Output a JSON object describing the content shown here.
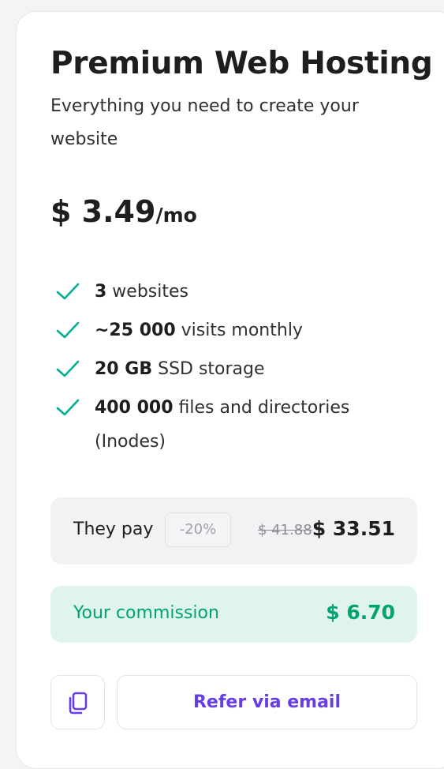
{
  "plan": {
    "title": "Premium Web Hosting",
    "subtitle": "Everything you need to create your website",
    "price": "$ 3.49",
    "price_period": "/mo"
  },
  "features": [
    {
      "bold": "3",
      "text": " websites"
    },
    {
      "bold": "~25 000",
      "text": " visits monthly"
    },
    {
      "bold": "20 GB",
      "text": " SSD storage"
    },
    {
      "bold": "400 000",
      "text": " files and directories (Inodes)"
    }
  ],
  "they_pay": {
    "label": "They pay",
    "discount": "-20%",
    "old_price": "$ 41.88",
    "new_price": "$ 33.51"
  },
  "commission": {
    "label": "Your commission",
    "value": "$ 6.70"
  },
  "actions": {
    "copy_icon": "copy-icon",
    "refer_label": "Refer via email"
  },
  "colors": {
    "accent": "#673de6",
    "success": "#00a372",
    "check": "#00b090"
  }
}
